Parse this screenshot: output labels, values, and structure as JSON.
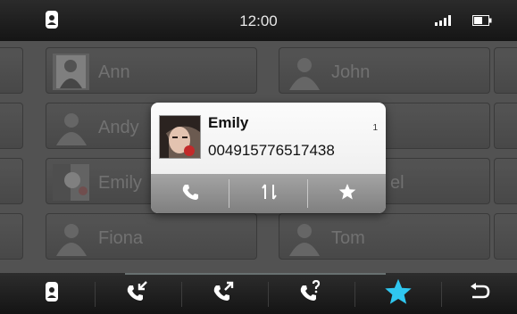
{
  "status_bar": {
    "time": "12:00",
    "left_icon": "phone-book-icon",
    "signal_icon": "signal-bars-icon",
    "battery_icon": "battery-icon"
  },
  "contacts": [
    {
      "name": "Ann",
      "avatar": "photo"
    },
    {
      "name": "John",
      "avatar": "silhouette"
    },
    {
      "name": "Andy",
      "avatar": "silhouette"
    },
    {
      "name": "",
      "avatar": "none"
    },
    {
      "name": "Emily",
      "avatar": "photo"
    },
    {
      "name": "el",
      "avatar": "none"
    },
    {
      "name": "Fiona",
      "avatar": "silhouette"
    },
    {
      "name": "Tom",
      "avatar": "silhouette"
    }
  ],
  "popup": {
    "name": "Emily",
    "number": "004915776517438",
    "badge": "1",
    "actions": [
      "call-icon",
      "transfer-icon",
      "favorite-star-icon"
    ]
  },
  "bottom_bar": {
    "items": [
      "phone-book-icon",
      "incoming-calls-icon",
      "outgoing-calls-icon",
      "missed-calls-icon",
      "favorites-star-icon",
      "back-icon"
    ],
    "active_index": 4
  },
  "colors": {
    "accent": "#2fc7f0",
    "background": "#5a5a5a",
    "popup_bg": "#f4f4f4"
  }
}
